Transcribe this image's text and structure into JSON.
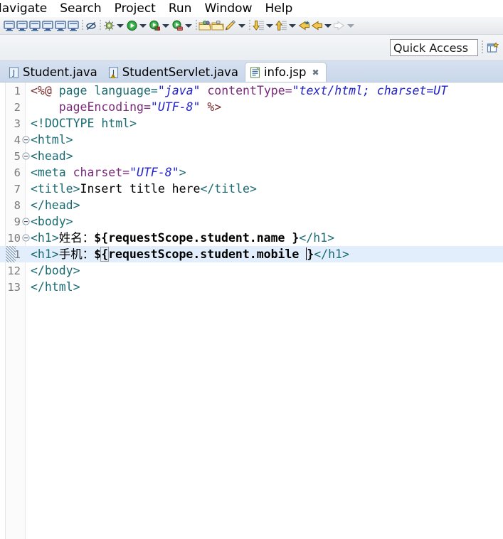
{
  "window": {
    "app": "Eclipse IDE",
    "perspective_icon": "open-perspective-icon"
  },
  "menubar": {
    "items": [
      {
        "label": "lavigate",
        "name": "menu-navigate",
        "clipped": true
      },
      {
        "label": "Search",
        "name": "menu-search",
        "clipped": false
      },
      {
        "label": "Project",
        "name": "menu-project",
        "clipped": false
      },
      {
        "label": "Run",
        "name": "menu-run",
        "clipped": false
      },
      {
        "label": "Window",
        "name": "menu-window",
        "clipped": false
      },
      {
        "label": "Help",
        "name": "menu-help",
        "clipped": false
      }
    ]
  },
  "toolbar": {
    "icons": [
      "console-1-icon",
      "console-2-icon",
      "console-3-icon",
      "console-4-icon",
      "console-5-icon",
      "console-6-icon",
      "separator",
      "link-with-editor-off-icon",
      "separator",
      "debug-icon",
      "debug-dropdown-arrow",
      "run-icon",
      "run-dropdown-arrow",
      "run-external-tools-icon",
      "run-external-dropdown-arrow",
      "run-server-icon",
      "run-server-dropdown-arrow",
      "separator",
      "new-package-icon",
      "new-folder-icon",
      "new-element-icon",
      "new-dropdown-arrow",
      "separator",
      "next-annotation-icon",
      "next-annotation-dropdown-arrow",
      "previous-annotation-icon",
      "previous-annotation-dropdown-arrow",
      "last-edit-location-icon",
      "back-icon",
      "back-dropdown-arrow",
      "forward-icon",
      "forward-dropdown-arrow"
    ]
  },
  "quick_access": {
    "placeholder": "Quick Access",
    "value": "Quick Access",
    "perspective_button": "open-perspective-icon"
  },
  "tabs": [
    {
      "label": "Student.java",
      "icon": "java-file-icon",
      "active": false,
      "closable": false,
      "name": "tab-student-java"
    },
    {
      "label": "StudentServlet.java",
      "icon": "java-file-warning-icon",
      "active": false,
      "closable": false,
      "name": "tab-student-servlet-java"
    },
    {
      "label": "info.jsp",
      "icon": "jsp-file-icon",
      "active": true,
      "closable": true,
      "close_glyph": "✖",
      "name": "tab-info-jsp"
    }
  ],
  "editor": {
    "file": "info.jsp",
    "cursor_line": 11,
    "total_lines": 13,
    "lines": [
      {
        "number": "1",
        "fold": false,
        "changed": false,
        "current": false,
        "tokens": [
          {
            "t": "<%@ ",
            "c": "dir"
          },
          {
            "t": "page ",
            "c": "attr2"
          },
          {
            "t": "language=",
            "c": "attr2"
          },
          {
            "t": "\"java\"",
            "c": "val"
          },
          {
            "t": " ",
            "c": "txt"
          },
          {
            "t": "contentType=",
            "c": "attr"
          },
          {
            "t": "\"text/html; charset=UT",
            "c": "val"
          }
        ]
      },
      {
        "number": "2",
        "fold": false,
        "changed": false,
        "current": false,
        "tokens": [
          {
            "t": "    ",
            "c": "txt"
          },
          {
            "t": "pageEncoding=",
            "c": "attr"
          },
          {
            "t": "\"UTF-8\"",
            "c": "val"
          },
          {
            "t": " ",
            "c": "txt"
          },
          {
            "t": "%>",
            "c": "dir"
          }
        ]
      },
      {
        "number": "3",
        "fold": false,
        "changed": false,
        "current": false,
        "tokens": [
          {
            "t": "<!DOCTYPE html>",
            "c": "tag"
          }
        ]
      },
      {
        "number": "4",
        "fold": true,
        "changed": false,
        "current": false,
        "tokens": [
          {
            "t": "<html>",
            "c": "tag"
          }
        ]
      },
      {
        "number": "5",
        "fold": true,
        "changed": false,
        "current": false,
        "tokens": [
          {
            "t": "<head>",
            "c": "tag"
          }
        ]
      },
      {
        "number": "6",
        "fold": false,
        "changed": false,
        "current": false,
        "tokens": [
          {
            "t": "<meta ",
            "c": "tag"
          },
          {
            "t": "charset=",
            "c": "attr"
          },
          {
            "t": "\"UTF-8\"",
            "c": "val"
          },
          {
            "t": ">",
            "c": "tag"
          }
        ]
      },
      {
        "number": "7",
        "fold": false,
        "changed": false,
        "current": false,
        "tokens": [
          {
            "t": "<title>",
            "c": "tag"
          },
          {
            "t": "Insert title here",
            "c": "txt"
          },
          {
            "t": "</title>",
            "c": "tag"
          }
        ]
      },
      {
        "number": "8",
        "fold": false,
        "changed": false,
        "current": false,
        "tokens": [
          {
            "t": "</head>",
            "c": "tag"
          }
        ]
      },
      {
        "number": "9",
        "fold": true,
        "changed": false,
        "current": false,
        "tokens": [
          {
            "t": "<body>",
            "c": "tag"
          }
        ]
      },
      {
        "number": "10",
        "fold": true,
        "changed": false,
        "current": false,
        "tokens": [
          {
            "t": "<h1>",
            "c": "tag"
          },
          {
            "t": "姓名：",
            "c": "txt"
          },
          {
            "t": "${requestScope.student.name }",
            "c": "el"
          },
          {
            "t": "</h1>",
            "c": "tag"
          }
        ]
      },
      {
        "number": "11",
        "fold": false,
        "changed": true,
        "current": true,
        "tokens": [
          {
            "t": "<h1>",
            "c": "tag"
          },
          {
            "t": "手机：",
            "c": "txt"
          },
          {
            "t": "$",
            "c": "el"
          },
          {
            "t": "{",
            "c": "brk"
          },
          {
            "t": "requestScope.student.mobile ",
            "c": "el"
          },
          {
            "t": "|CARET|",
            "c": "caret"
          },
          {
            "t": "}",
            "c": "el"
          },
          {
            "t": "</h1>",
            "c": "tag"
          }
        ]
      },
      {
        "number": "12",
        "fold": false,
        "changed": false,
        "current": false,
        "tokens": [
          {
            "t": "</body>",
            "c": "tag"
          }
        ]
      },
      {
        "number": "13",
        "fold": false,
        "changed": false,
        "current": false,
        "tokens": [
          {
            "t": "</html>",
            "c": "tag"
          }
        ]
      }
    ]
  },
  "colors": {
    "tag": "#1a6b72",
    "directive": "#7c2f2f",
    "attribute": "#7a2a7a",
    "value": "#2222cc",
    "text": "#000000",
    "current_line": "#e3eefc",
    "tab_bar": "#c9d7ea",
    "line_number": "#7b7b7b"
  }
}
